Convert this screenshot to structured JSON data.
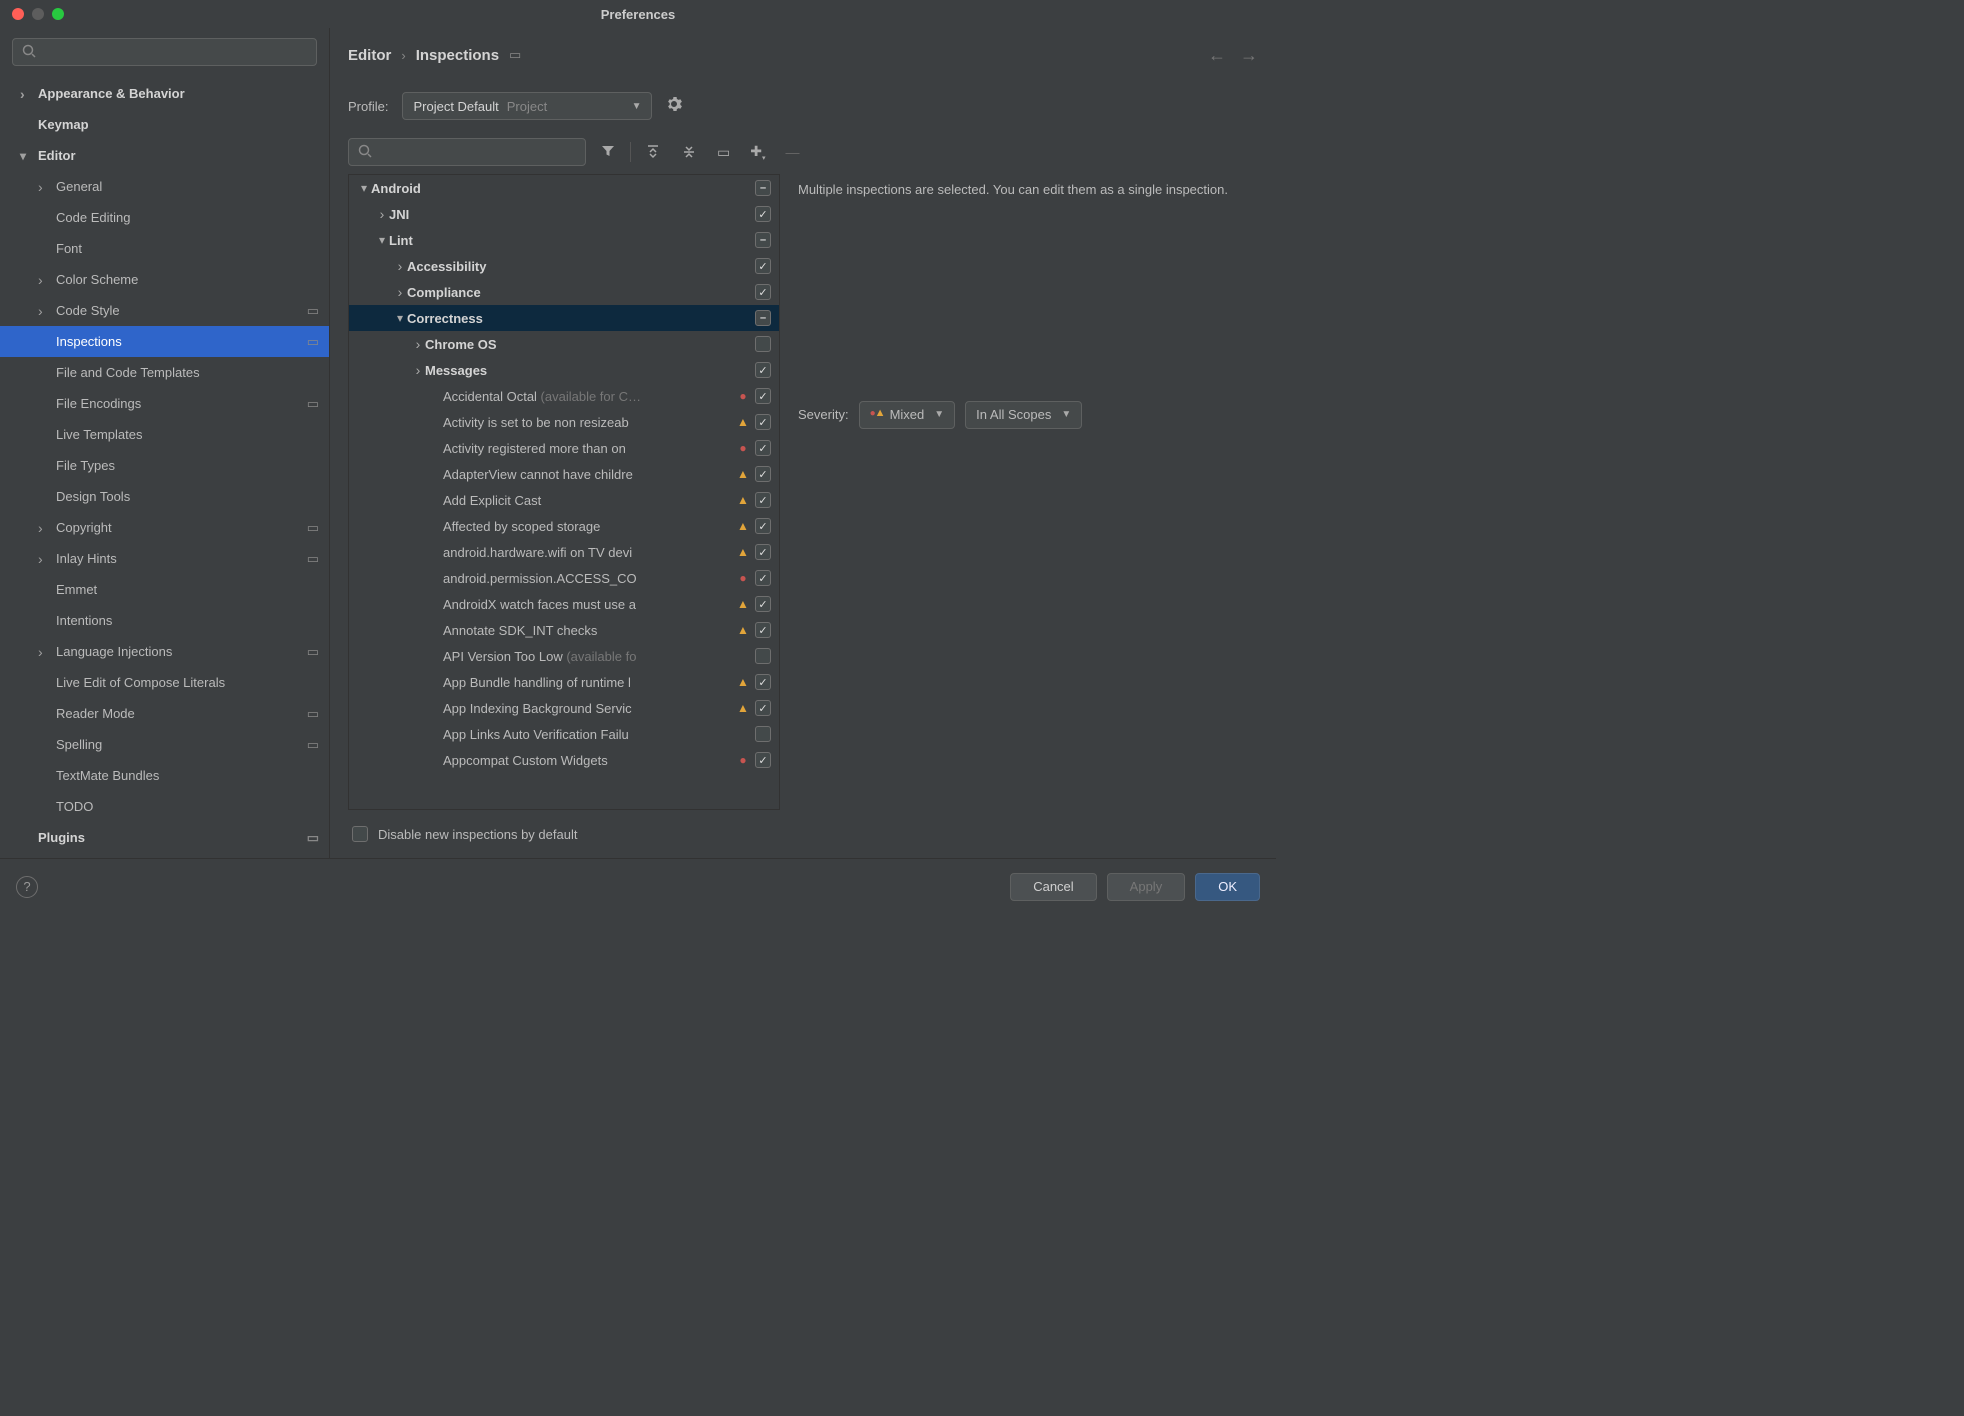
{
  "window": {
    "title": "Preferences"
  },
  "sidebar": {
    "search_placeholder": "",
    "items": [
      {
        "label": "Appearance & Behavior",
        "bold": true,
        "arrow": "right",
        "lvl": 0
      },
      {
        "label": "Keymap",
        "bold": true,
        "lvl": 0
      },
      {
        "label": "Editor",
        "bold": true,
        "arrow": "down",
        "lvl": 0
      },
      {
        "label": "General",
        "arrow": "right",
        "lvl": 1
      },
      {
        "label": "Code Editing",
        "lvl": 1
      },
      {
        "label": "Font",
        "lvl": 1
      },
      {
        "label": "Color Scheme",
        "arrow": "right",
        "lvl": 1
      },
      {
        "label": "Code Style",
        "arrow": "right",
        "lvl": 1,
        "proj": true
      },
      {
        "label": "Inspections",
        "lvl": 1,
        "proj": true,
        "selected": true
      },
      {
        "label": "File and Code Templates",
        "lvl": 1
      },
      {
        "label": "File Encodings",
        "lvl": 1,
        "proj": true
      },
      {
        "label": "Live Templates",
        "lvl": 1
      },
      {
        "label": "File Types",
        "lvl": 1
      },
      {
        "label": "Design Tools",
        "lvl": 1
      },
      {
        "label": "Copyright",
        "arrow": "right",
        "lvl": 1,
        "proj": true
      },
      {
        "label": "Inlay Hints",
        "arrow": "right",
        "lvl": 1,
        "proj": true
      },
      {
        "label": "Emmet",
        "lvl": 1
      },
      {
        "label": "Intentions",
        "lvl": 1
      },
      {
        "label": "Language Injections",
        "arrow": "right",
        "lvl": 1,
        "proj": true
      },
      {
        "label": "Live Edit of Compose Literals",
        "lvl": 1
      },
      {
        "label": "Reader Mode",
        "lvl": 1,
        "proj": true
      },
      {
        "label": "Spelling",
        "lvl": 1,
        "proj": true
      },
      {
        "label": "TextMate Bundles",
        "lvl": 1
      },
      {
        "label": "TODO",
        "lvl": 1
      },
      {
        "label": "Plugins",
        "bold": true,
        "lvl": 0,
        "proj": true
      }
    ]
  },
  "breadcrumb": {
    "a": "Editor",
    "b": "Inspections"
  },
  "profile": {
    "label": "Profile:",
    "value": "Project Default",
    "badge": "Project"
  },
  "detail": {
    "text": "Multiple inspections are selected. You can edit them as a single inspection.",
    "severity_label": "Severity:",
    "severity_value": "Mixed",
    "scope_value": "In All Scopes"
  },
  "disable_label": "Disable new inspections by default",
  "footer": {
    "cancel": "Cancel",
    "apply": "Apply",
    "ok": "OK"
  },
  "inspections": [
    {
      "pad": 0,
      "arrow": "down",
      "label": "Android",
      "bold": true,
      "chk": "mixed"
    },
    {
      "pad": 1,
      "arrow": "right",
      "label": "JNI",
      "bold": true,
      "chk": "checked"
    },
    {
      "pad": 1,
      "arrow": "down",
      "label": "Lint",
      "bold": true,
      "chk": "mixed"
    },
    {
      "pad": 2,
      "arrow": "right",
      "label": "Accessibility",
      "bold": true,
      "chk": "checked"
    },
    {
      "pad": 2,
      "arrow": "right",
      "label": "Compliance",
      "bold": true,
      "chk": "checked"
    },
    {
      "pad": 2,
      "arrow": "down",
      "label": "Correctness",
      "bold": true,
      "chk": "mixed",
      "selected": true
    },
    {
      "pad": 3,
      "arrow": "right",
      "label": "Chrome OS",
      "bold": true,
      "chk": ""
    },
    {
      "pad": 3,
      "arrow": "right",
      "label": "Messages",
      "bold": true,
      "chk": "checked"
    },
    {
      "pad": 4,
      "label": "Accidental Octal",
      "hint": " (available for C…",
      "sev": "err",
      "chk": "checked"
    },
    {
      "pad": 4,
      "label": "Activity is set to be non resizeab",
      "sev": "warn",
      "chk": "checked"
    },
    {
      "pad": 4,
      "label": "Activity registered more than on",
      "sev": "err",
      "chk": "checked"
    },
    {
      "pad": 4,
      "label": "AdapterView cannot have childre",
      "sev": "warn",
      "chk": "checked"
    },
    {
      "pad": 4,
      "label": "Add Explicit Cast",
      "sev": "warn",
      "chk": "checked"
    },
    {
      "pad": 4,
      "label": "Affected by scoped storage",
      "sev": "warn",
      "chk": "checked"
    },
    {
      "pad": 4,
      "label": "android.hardware.wifi on TV devi",
      "sev": "warn",
      "chk": "checked"
    },
    {
      "pad": 4,
      "label": "android.permission.ACCESS_CO",
      "sev": "err",
      "chk": "checked"
    },
    {
      "pad": 4,
      "label": "AndroidX watch faces must use a",
      "sev": "warn",
      "chk": "checked"
    },
    {
      "pad": 4,
      "label": "Annotate SDK_INT checks",
      "sev": "warn",
      "chk": "checked"
    },
    {
      "pad": 4,
      "label": "API Version Too Low",
      "hint": " (available fo",
      "chk": ""
    },
    {
      "pad": 4,
      "label": "App Bundle handling of runtime l",
      "sev": "warn",
      "chk": "checked"
    },
    {
      "pad": 4,
      "label": "App Indexing Background Servic",
      "sev": "warn",
      "chk": "checked"
    },
    {
      "pad": 4,
      "label": "App Links Auto Verification Failu",
      "chk": ""
    },
    {
      "pad": 4,
      "label": "Appcompat Custom Widgets",
      "sev": "err",
      "chk": "checked"
    }
  ]
}
